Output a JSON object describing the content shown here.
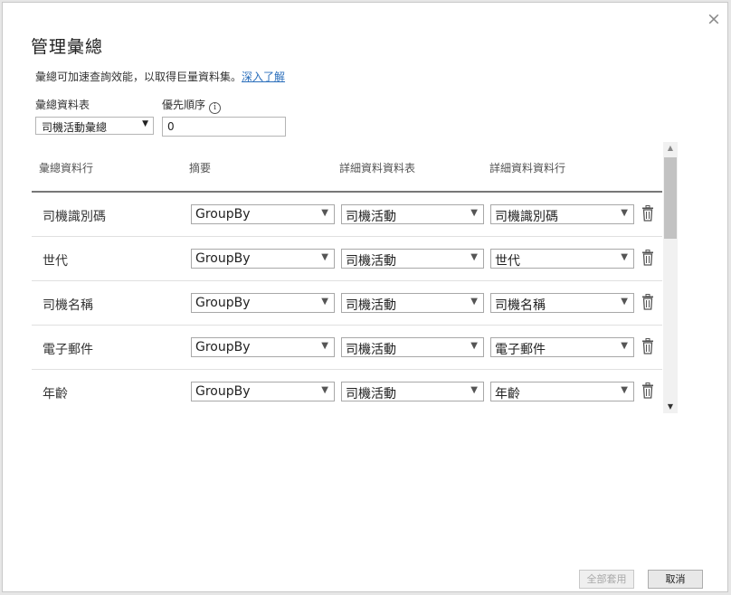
{
  "dialog": {
    "title": "管理彙總",
    "description": "彙總可加速查詢效能，以取得巨量資料集。",
    "learn_more": "深入了解",
    "close_icon": "×"
  },
  "table_field": {
    "label": "彙總資料表",
    "value": "司機活動彙總"
  },
  "priority_field": {
    "label": "優先順序",
    "value": "0",
    "info_icon": "i"
  },
  "columns": {
    "aggregation_column": "彙總資料行",
    "summarization": "摘要",
    "detail_table": "詳細資料資料表",
    "detail_column": "詳細資料資料行"
  },
  "rows": [
    {
      "name": "司機識別碼",
      "summarization": "GroupBy",
      "detail_table": "司機活動",
      "detail_column": "司機識別碼"
    },
    {
      "name": "世代",
      "summarization": "GroupBy",
      "detail_table": "司機活動",
      "detail_column": "世代"
    },
    {
      "name": "司機名稱",
      "summarization": "GroupBy",
      "detail_table": "司機活動",
      "detail_column": "司機名稱"
    },
    {
      "name": "電子郵件",
      "summarization": "GroupBy",
      "detail_table": "司機活動",
      "detail_column": "電子郵件"
    },
    {
      "name": "年齡",
      "summarization": "GroupBy",
      "detail_table": "司機活動",
      "detail_column": "年齡"
    }
  ],
  "footer": {
    "apply_all": "全部套用",
    "cancel": "取消"
  }
}
